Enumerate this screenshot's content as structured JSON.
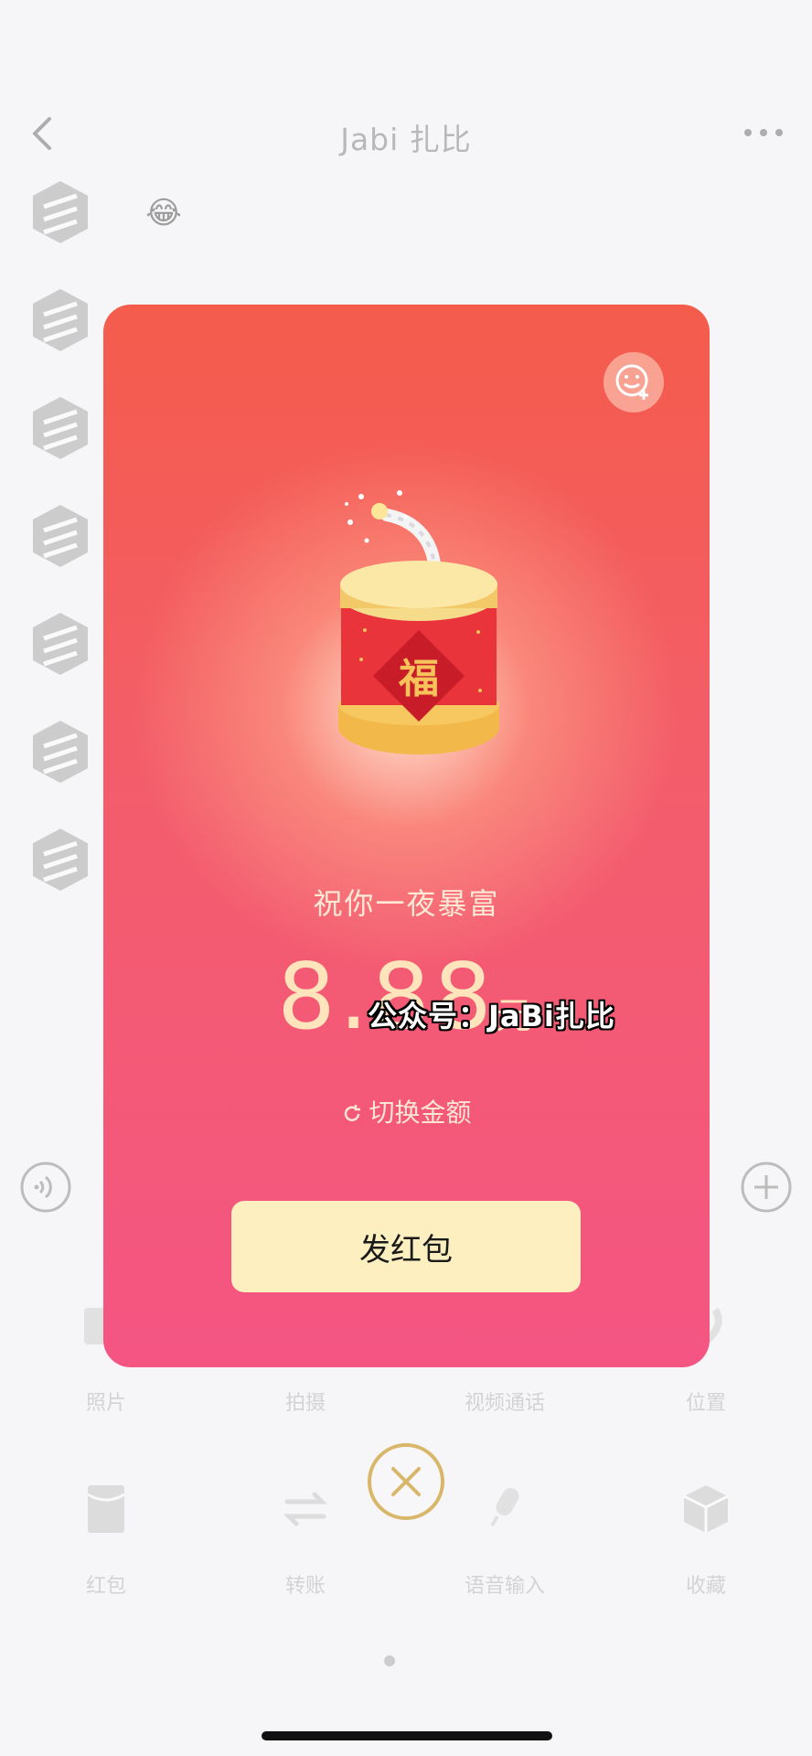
{
  "nav": {
    "title": "Jabi 扎比"
  },
  "chat": {
    "emoji": "😂"
  },
  "panel": {
    "row1": [
      "照片",
      "拍摄",
      "视频通话",
      "位置"
    ],
    "row2": [
      "红包",
      "转账",
      "语音输入",
      "收藏"
    ]
  },
  "packet": {
    "blessing": "祝你一夜暴富",
    "amount": "8.88",
    "amount_unit": "元",
    "switch_label": "切换金额",
    "send_label": "发红包",
    "badge_char": "福"
  },
  "watermark": "公众号：JaBi扎比",
  "colors": {
    "card_top": "#f45c4c",
    "card_bottom": "#f45583",
    "send_button": "#fdefc0",
    "amount_text": "#ffe4bc",
    "close_ring": "#d9b76a"
  },
  "icons": {
    "back": "chevron-left-icon",
    "more": "more-dots-icon",
    "sticker": "emoji-add-icon",
    "switch": "refresh-icon",
    "close": "close-icon",
    "voice": "voice-icon",
    "plus": "plus-icon"
  }
}
